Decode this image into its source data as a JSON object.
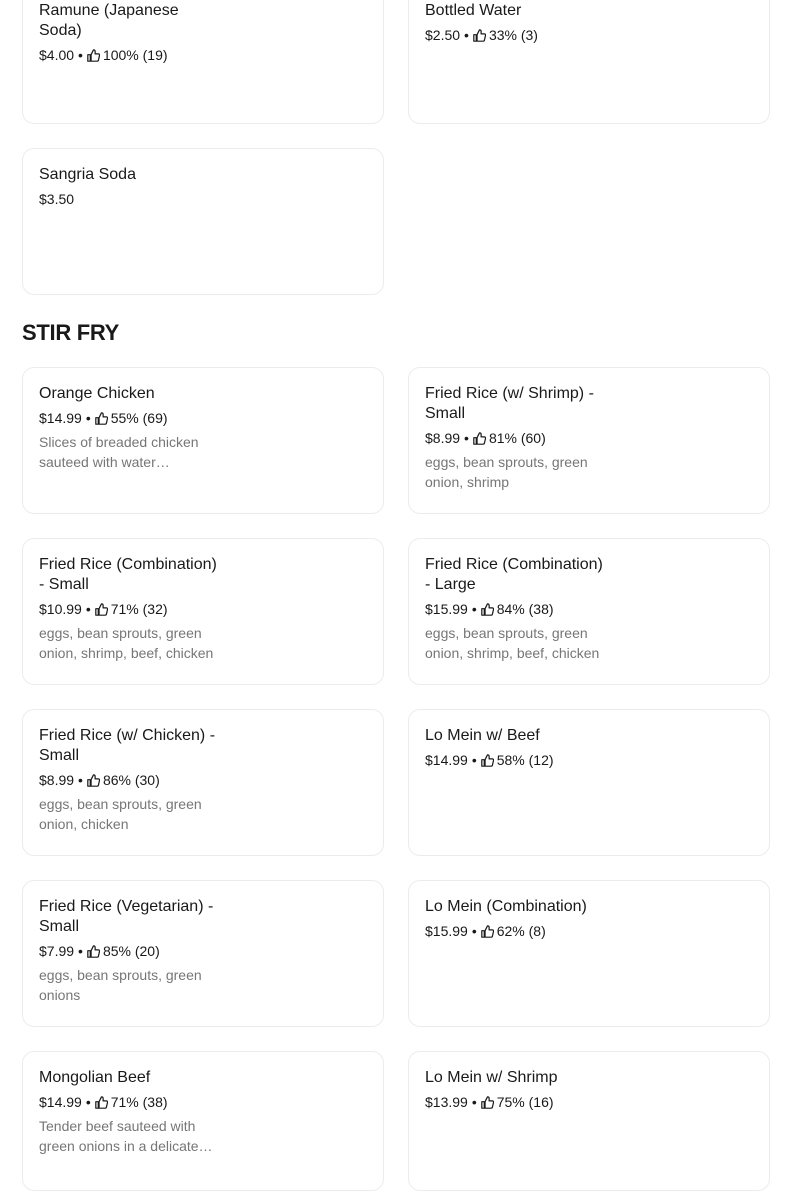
{
  "drinks": [
    {
      "name": "Ramune (Japanese Soda)",
      "price": "$4.00",
      "rating": "100% (19)"
    },
    {
      "name": "Bottled Water",
      "price": "$2.50",
      "rating": "33% (3)"
    },
    {
      "name": "Sangria Soda",
      "price": "$3.50"
    }
  ],
  "stir_fry": {
    "title": "STIR FRY",
    "items": [
      {
        "name": "Orange Chicken",
        "price": "$14.99",
        "rating": "55% (69)",
        "desc": "Slices of breaded chicken sauteed with water…"
      },
      {
        "name": "Fried Rice (w/ Shrimp) - Small",
        "price": "$8.99",
        "rating": "81% (60)",
        "desc": "eggs, bean sprouts, green onion, shrimp"
      },
      {
        "name": "Fried Rice (Combination) - Small",
        "price": "$10.99",
        "rating": "71% (32)",
        "desc": "eggs, bean sprouts, green onion, shrimp, beef, chicken"
      },
      {
        "name": "Fried Rice (Combination) - Large",
        "price": "$15.99",
        "rating": "84% (38)",
        "desc": "eggs, bean sprouts, green onion, shrimp, beef, chicken"
      },
      {
        "name": "Fried Rice (w/ Chicken) - Small",
        "price": "$8.99",
        "rating": "86% (30)",
        "desc": "eggs, bean sprouts, green onion, chicken"
      },
      {
        "name": "Lo Mein w/ Beef",
        "price": "$14.99",
        "rating": "58% (12)"
      },
      {
        "name": "Fried Rice (Vegetarian) - Small",
        "price": "$7.99",
        "rating": "85% (20)",
        "desc": "eggs, bean sprouts, green onions"
      },
      {
        "name": "Lo Mein (Combination)",
        "price": "$15.99",
        "rating": "62% (8)"
      },
      {
        "name": "Mongolian Beef",
        "price": "$14.99",
        "rating": "71% (38)",
        "desc": "Tender beef sauteed with green onions in a delicate…"
      },
      {
        "name": "Lo Mein w/ Shrimp",
        "price": "$13.99",
        "rating": "75% (16)"
      }
    ]
  },
  "icons": {
    "rating": "thumbs-up-icon"
  },
  "separator": "•"
}
